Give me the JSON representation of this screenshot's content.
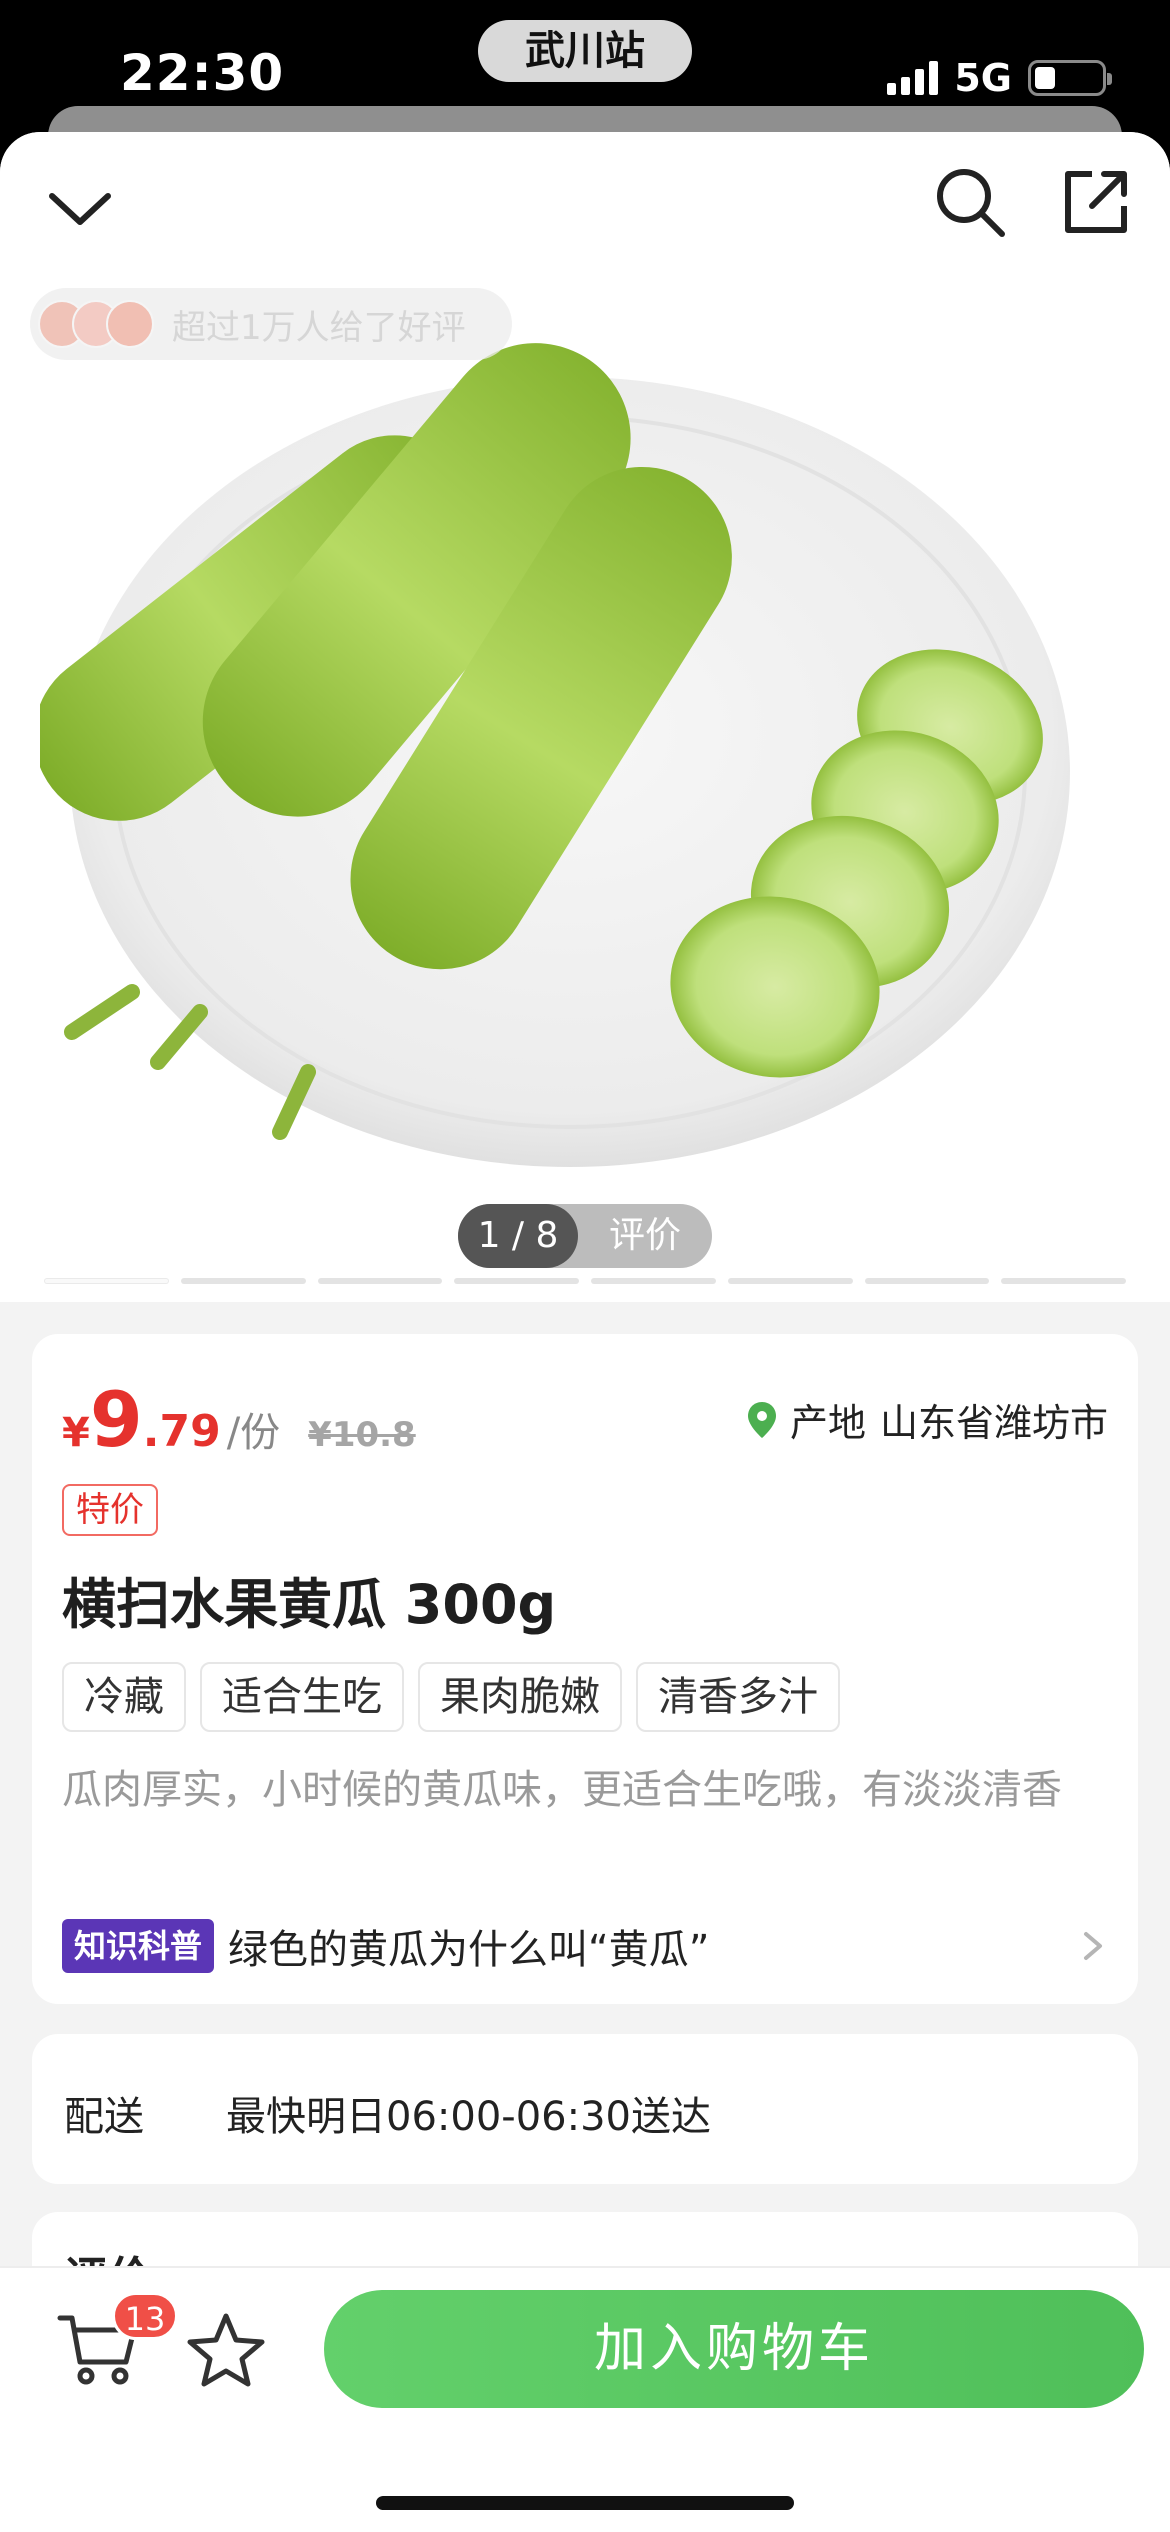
{
  "status_bar": {
    "time": "22:30",
    "station": "武川站",
    "network": "5G",
    "battery_level": 0.3
  },
  "nav": {
    "collapse_icon": "chevron-down-icon",
    "search_icon": "search-icon",
    "share_icon": "share-icon"
  },
  "hero": {
    "review_banner": "超过1万人给了好评",
    "pager": {
      "count": "1 / 8",
      "review_label": "评价"
    },
    "slide_index": 1,
    "slide_total": 8
  },
  "product": {
    "price": {
      "currency": "¥",
      "integer": "9",
      "decimal": ".79",
      "unit": "/份",
      "original": "¥10.8"
    },
    "origin": {
      "label": "产地",
      "value": "山东省潍坊市"
    },
    "special_tag": "特价",
    "title": "横扫水果黄瓜 300g",
    "tags": [
      "冷藏",
      "适合生吃",
      "果肉脆嫩",
      "清香多汁"
    ],
    "description": "瓜肉厚实，小时候的黄瓜味，更适合生吃哦，有淡淡清香",
    "knowledge": {
      "badge": "知识科普",
      "text": "绿色的黄瓜为什么叫“黄瓜”"
    }
  },
  "delivery": {
    "label": "配送",
    "value": "最快明日06:00-06:30送达"
  },
  "review_section": {
    "label": "评价"
  },
  "bottom_bar": {
    "cart_count": "13",
    "add_to_cart": "加入购物车"
  },
  "colors": {
    "price_red": "#e5322d",
    "accent_green": "#55c45f",
    "badge_purple": "#5b36b6"
  }
}
